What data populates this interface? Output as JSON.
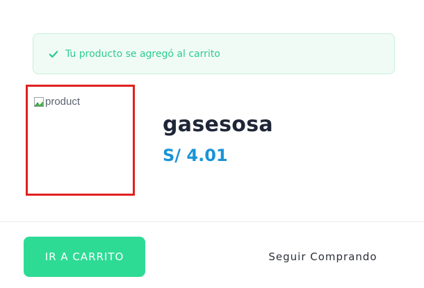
{
  "alert": {
    "message": "Tu producto se agregó al carrito",
    "icon": "check-icon",
    "color": "#2ecc8e"
  },
  "product": {
    "image_alt": "product",
    "name": "gasesosa",
    "price": "S/ 4.01"
  },
  "actions": {
    "go_to_cart_label": "IR A CARRITO",
    "continue_label": "Seguir Comprando"
  },
  "colors": {
    "primary": "#2edb95",
    "price": "#1b93d6",
    "highlight": "#e0201f"
  }
}
